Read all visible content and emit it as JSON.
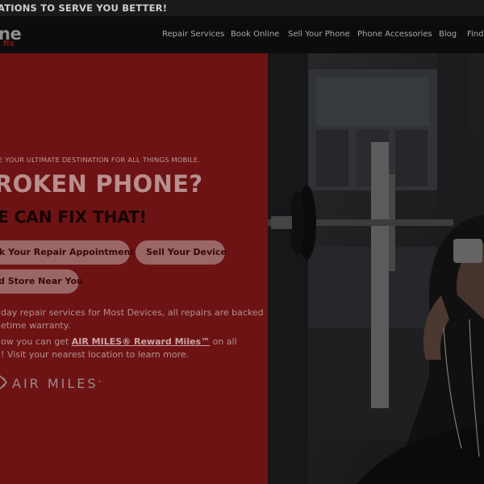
{
  "announcement": {
    "text": "ATIONS TO SERVE YOU BETTER!"
  },
  "nav": {
    "logo": {
      "main": "ne",
      "sub": "fix"
    },
    "links": [
      "Repair Services",
      "Book Online",
      "Sell Your Phone",
      "Phone Accessories",
      "Blog",
      "Find"
    ]
  },
  "hero": {
    "tagline": "E YOUR ULTIMATE DESTINATION FOR ALL THINGS MOBILE.",
    "headline": "ROKEN PHONE?",
    "subheadline": "E CAN FIX THAT!",
    "buttons": {
      "book": "k Your Repair Appointment",
      "sell": "Sell Your Device",
      "store": "d Store Near You"
    },
    "paragraph1": [
      "day repair services for Most Devices, all repairs are backed",
      "etime warranty."
    ],
    "paragraph2": {
      "line1_prefix": "ow you can get ",
      "line1_link": "AIR MILES® Reward Miles™",
      "line1_suffix": " on all",
      "line2": "! Visit your nearest location to learn more."
    },
    "airmiles_logo_text": "AIR MILES"
  },
  "colors": {
    "hero_left_bg": "#6d1313",
    "nav_bg": "#0c0c0c",
    "button_bg": "#9a6767",
    "overlay": "rgba(0,0,0,0.55)"
  },
  "icons": [
    "airmiles-logo-icon"
  ]
}
